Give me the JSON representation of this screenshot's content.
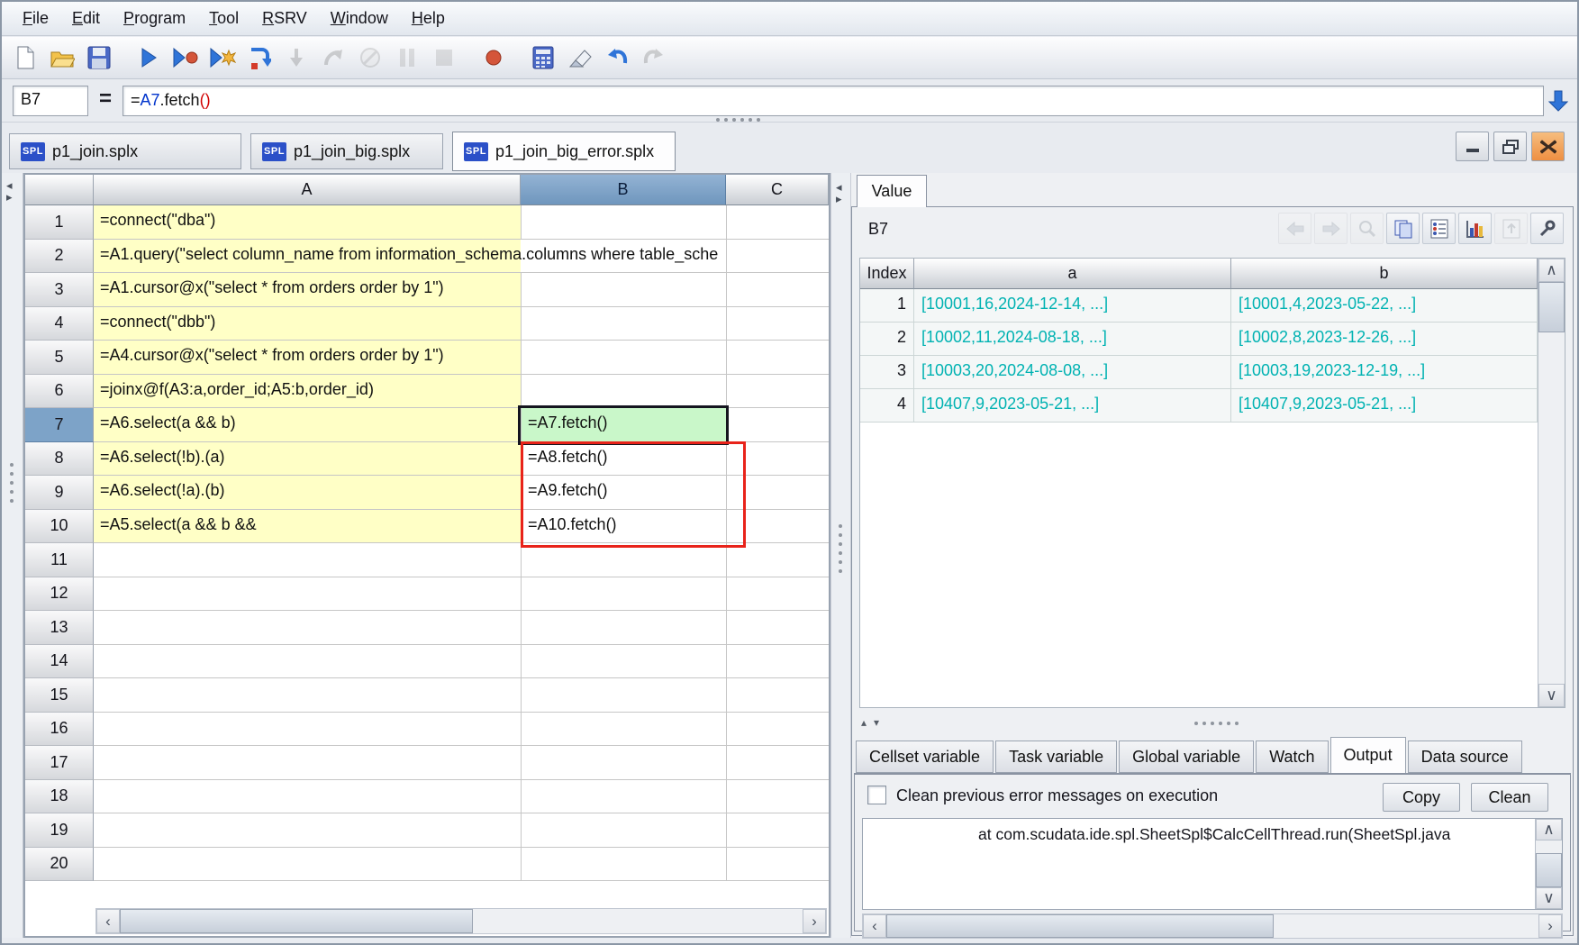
{
  "menu": {
    "items": [
      {
        "mnemonic": "F",
        "rest": "ile"
      },
      {
        "mnemonic": "E",
        "rest": "dit"
      },
      {
        "mnemonic": "P",
        "rest": "rogram"
      },
      {
        "mnemonic": "T",
        "rest": "ool"
      },
      {
        "mnemonic": "R",
        "rest": "SRV"
      },
      {
        "mnemonic": "W",
        "rest": "indow"
      },
      {
        "mnemonic": "H",
        "rest": "elp"
      }
    ]
  },
  "toolbar": {
    "icons": [
      {
        "name": "new-file",
        "enabled": true
      },
      {
        "name": "open-file",
        "enabled": true
      },
      {
        "name": "save",
        "enabled": true
      },
      {
        "name": "run",
        "enabled": true
      },
      {
        "name": "run-debug",
        "enabled": true
      },
      {
        "name": "execute-cell",
        "enabled": true
      },
      {
        "name": "step-over",
        "enabled": true
      },
      {
        "name": "step-into",
        "enabled": false
      },
      {
        "name": "step-return",
        "enabled": false
      },
      {
        "name": "cancel",
        "enabled": false
      },
      {
        "name": "pause",
        "enabled": false
      },
      {
        "name": "stop",
        "enabled": false
      },
      {
        "name": "breakpoint",
        "enabled": true
      },
      {
        "name": "calculator",
        "enabled": true
      },
      {
        "name": "clear",
        "enabled": true
      },
      {
        "name": "undo",
        "enabled": true
      },
      {
        "name": "redo",
        "enabled": false
      }
    ]
  },
  "formula_bar": {
    "cell_ref": "B7",
    "equals_label": "=",
    "formula_parts": [
      {
        "text": "="
      },
      {
        "text": "A7"
      },
      {
        "text": ".fetch"
      },
      {
        "text": "()"
      }
    ]
  },
  "file_tabs": [
    {
      "icon_label": "SPL",
      "label": "p1_join.splx",
      "active": false
    },
    {
      "icon_label": "SPL",
      "label": "p1_join_big.splx",
      "active": false
    },
    {
      "icon_label": "SPL",
      "label": "p1_join_big_error.splx",
      "active": true
    }
  ],
  "window_controls": [
    "minimize",
    "restore",
    "close"
  ],
  "sheet": {
    "columns": [
      "A",
      "B",
      "C"
    ],
    "selected_column": "B",
    "selected_row": "7",
    "selected_cell": "B7",
    "error_highlight_range": "B8:B10",
    "rows": [
      {
        "n": "1",
        "a": "=connect(\"dba\")",
        "b": ""
      },
      {
        "n": "2",
        "a": "=A1.query(\"select column_name from information_schema.columns where table_sche",
        "b": ""
      },
      {
        "n": "3",
        "a": "=A1.cursor@x(\"select * from orders order by 1\")",
        "b": ""
      },
      {
        "n": "4",
        "a": "=connect(\"dbb\")",
        "b": ""
      },
      {
        "n": "5",
        "a": "=A4.cursor@x(\"select * from orders order by 1\")",
        "b": ""
      },
      {
        "n": "6",
        "a": "=joinx@f(A3:a,order_id;A5:b,order_id)",
        "b": ""
      },
      {
        "n": "7",
        "a": "=A6.select(a && b)",
        "b": "=A7.fetch()"
      },
      {
        "n": "8",
        "a": "=A6.select(!b).(a)",
        "b": "=A8.fetch()"
      },
      {
        "n": "9",
        "a": "=A6.select(!a).(b)",
        "b": "=A9.fetch()"
      },
      {
        "n": "10",
        "a": "=A5.select(a && b &&",
        "b": "=A10.fetch()"
      },
      {
        "n": "11",
        "a": "",
        "b": ""
      },
      {
        "n": "12",
        "a": "",
        "b": ""
      },
      {
        "n": "13",
        "a": "",
        "b": ""
      },
      {
        "n": "14",
        "a": "",
        "b": ""
      },
      {
        "n": "15",
        "a": "",
        "b": ""
      },
      {
        "n": "16",
        "a": "",
        "b": ""
      },
      {
        "n": "17",
        "a": "",
        "b": ""
      },
      {
        "n": "18",
        "a": "",
        "b": ""
      },
      {
        "n": "19",
        "a": "",
        "b": ""
      },
      {
        "n": "20",
        "a": "",
        "b": ""
      }
    ]
  },
  "value_panel": {
    "tab_label": "Value",
    "cell_ref": "B7",
    "toolbar_icons": [
      {
        "name": "back",
        "enabled": false
      },
      {
        "name": "forward",
        "enabled": false
      },
      {
        "name": "preview",
        "enabled": false
      },
      {
        "name": "copy",
        "enabled": true
      },
      {
        "name": "properties",
        "enabled": true
      },
      {
        "name": "chart",
        "enabled": true
      },
      {
        "name": "export",
        "enabled": false
      },
      {
        "name": "pin",
        "enabled": true
      }
    ],
    "table": {
      "headers": [
        "Index",
        "a",
        "b"
      ],
      "rows": [
        {
          "index": "1",
          "a": "[10001,16,2024-12-14, ...]",
          "b": "[10001,4,2023-05-22, ...]"
        },
        {
          "index": "2",
          "a": "[10002,11,2024-08-18, ...]",
          "b": "[10002,8,2023-12-26, ...]"
        },
        {
          "index": "3",
          "a": "[10003,20,2024-08-08, ...]",
          "b": "[10003,19,2023-12-19, ...]"
        },
        {
          "index": "4",
          "a": "[10407,9,2023-05-21, ...]",
          "b": "[10407,9,2023-05-21, ...]"
        }
      ]
    }
  },
  "bottom_tabs": [
    {
      "label": "Cellset variable",
      "active": false
    },
    {
      "label": "Task variable",
      "active": false
    },
    {
      "label": "Global variable",
      "active": false
    },
    {
      "label": "Watch",
      "active": false
    },
    {
      "label": "Output",
      "active": true
    },
    {
      "label": "Data source",
      "active": false
    }
  ],
  "output_panel": {
    "checkbox_label": "Clean previous error messages on execution",
    "checkbox_checked": false,
    "copy_button": "Copy",
    "clean_button": "Clean",
    "error_text": "at com.scudata.ide.spl.SheetSpl$CalcCellThread.run(SheetSpl.java"
  },
  "icons": {
    "scroll_left": "‹",
    "scroll_right": "›",
    "scroll_up": "∧",
    "scroll_down": "∨",
    "splitter_up": "▴",
    "splitter_down": "▾",
    "collapse_left": "◂",
    "collapse_right": "▸"
  },
  "colors": {
    "selected_header_blue": "#7da3c8",
    "selected_cell_green": "#c9f7c9",
    "cell_yellow": "#ffffc6",
    "error_red": "#e8231a",
    "value_teal": "#00b2b2",
    "formula_ref_blue": "#0033cc",
    "formula_paren_red": "#d10000",
    "spl_icon_blue": "#2b50c8",
    "close_button_orange": "#ee8f42"
  }
}
